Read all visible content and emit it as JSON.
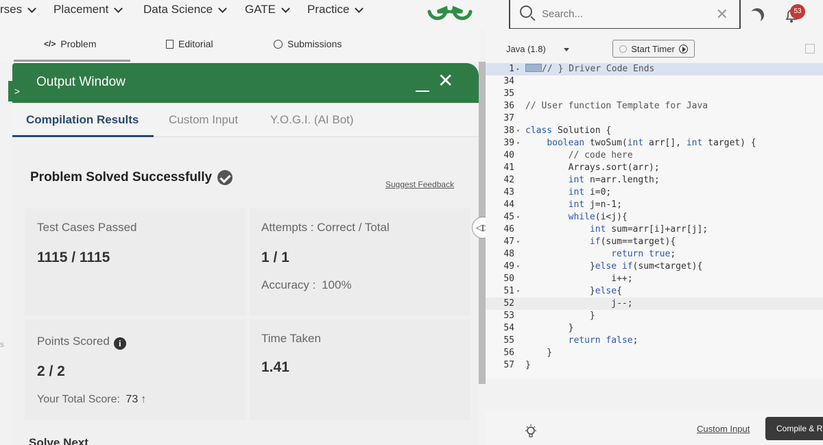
{
  "nav": {
    "items": [
      "rses",
      "Placement",
      "Data Science",
      "GATE",
      "Practice"
    ],
    "search_placeholder": "Search...",
    "notification_count": "53"
  },
  "problem_tabs": [
    "Problem",
    "Editorial",
    "Submissions"
  ],
  "output_window": {
    "title": "Output Window",
    "tabs": [
      "Compilation Results",
      "Custom Input",
      "Y.O.G.I. (AI Bot)"
    ],
    "status": "Problem Solved Successfully",
    "suggest_feedback": "Suggest Feedback",
    "test_cases_label": "Test Cases Passed",
    "test_cases_value": "1115 / 1115",
    "attempts_label": "Attempts : Correct / Total",
    "attempts_value": "1 / 1",
    "accuracy_label": "Accuracy :",
    "accuracy_value": "100%",
    "points_label": "Points Scored",
    "points_value": "2 / 2",
    "time_label": "Time Taken",
    "time_value": "1.41",
    "total_score_label": "Your Total Score:",
    "total_score_value": "73",
    "solve_next": "Solve Next",
    "left_edge_char": "s"
  },
  "editor": {
    "language": "Java (1.8)",
    "start_timer": "Start Timer",
    "lines": [
      {
        "n": "1",
        "fold": "▸",
        "text": "// } Driver Code Ends"
      },
      {
        "n": "34",
        "fold": "",
        "text": ""
      },
      {
        "n": "35",
        "fold": "",
        "text": ""
      },
      {
        "n": "36",
        "fold": "",
        "text": "// User function Template for Java"
      },
      {
        "n": "37",
        "fold": "",
        "text": ""
      },
      {
        "n": "38",
        "fold": "▾",
        "text": "class Solution {"
      },
      {
        "n": "39",
        "fold": "▾",
        "text": "    boolean twoSum(int arr[], int target) {"
      },
      {
        "n": "40",
        "fold": "",
        "text": "        // code here"
      },
      {
        "n": "41",
        "fold": "",
        "text": "        Arrays.sort(arr);"
      },
      {
        "n": "42",
        "fold": "",
        "text": "        int n=arr.length;"
      },
      {
        "n": "43",
        "fold": "",
        "text": "        int i=0;"
      },
      {
        "n": "44",
        "fold": "",
        "text": "        int j=n-1;"
      },
      {
        "n": "45",
        "fold": "▾",
        "text": "        while(i<j){"
      },
      {
        "n": "46",
        "fold": "",
        "text": "            int sum=arr[i]+arr[j];"
      },
      {
        "n": "47",
        "fold": "▾",
        "text": "            if(sum==target){"
      },
      {
        "n": "48",
        "fold": "",
        "text": "                return true;"
      },
      {
        "n": "49",
        "fold": "▾",
        "text": "            }else if(sum<target){"
      },
      {
        "n": "50",
        "fold": "",
        "text": "                i++;"
      },
      {
        "n": "51",
        "fold": "▾",
        "text": "            }else{"
      },
      {
        "n": "52",
        "fold": "",
        "text": "                j--;"
      },
      {
        "n": "53",
        "fold": "",
        "text": "            }"
      },
      {
        "n": "54",
        "fold": "",
        "text": "        }"
      },
      {
        "n": "55",
        "fold": "",
        "text": "        return false;"
      },
      {
        "n": "56",
        "fold": "",
        "text": "    }"
      },
      {
        "n": "57",
        "fold": "",
        "text": "}"
      }
    ],
    "custom_input": "Custom Input",
    "compile_run": "Compile & R"
  }
}
